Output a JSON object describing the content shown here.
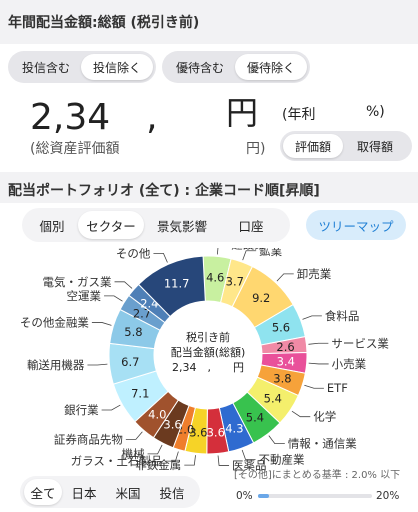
{
  "header": {
    "title": "年間配当金額:総額 (税引き前)",
    "segment1": [
      {
        "label": "投信含む",
        "selected": false
      },
      {
        "label": "投信除く",
        "selected": true
      }
    ],
    "segment2": [
      {
        "label": "優待含む",
        "selected": false
      },
      {
        "label": "優待除く",
        "selected": true
      }
    ]
  },
  "summary": {
    "amount": "2,34　,",
    "yen": "円",
    "annual_rate_open": "(年利",
    "percent_close": "%)",
    "asset_label": "(総資産評価額",
    "asset_yen": "円)",
    "basis_tabs": [
      {
        "label": "評価額",
        "selected": true
      },
      {
        "label": "取得額",
        "selected": false
      }
    ]
  },
  "portfolio": {
    "title": "配当ポートフォリオ (全て) : 企業コード順[昇順]",
    "tabs": [
      {
        "label": "個別",
        "selected": false
      },
      {
        "label": "セクター",
        "selected": true
      },
      {
        "label": "景気影響",
        "selected": false
      },
      {
        "label": "口座",
        "selected": false
      }
    ],
    "treemap_label": "ツリーマップ"
  },
  "donut_center": {
    "line1": "税引き前",
    "line2": "配当金額(総額)",
    "line3": "2,34　,　　円"
  },
  "chart_data": {
    "type": "pie",
    "donut": true,
    "unit": "%",
    "slices": [
      {
        "label": "建設業",
        "value": 4.6,
        "color": "#c8f0a0"
      },
      {
        "label": "鉱業",
        "value": 3.7,
        "color": "#ffe78a"
      },
      {
        "label": "卸売業",
        "value": 9.2,
        "color": "#ffd770"
      },
      {
        "label": "食料品",
        "value": 5.6,
        "color": "#8fe3ef"
      },
      {
        "label": "サービス業",
        "value": 2.6,
        "color": "#f08aa6"
      },
      {
        "label": "小売業",
        "value": 3.4,
        "color": "#e9509a"
      },
      {
        "label": "ETF",
        "value": 3.8,
        "color": "#f6a23a"
      },
      {
        "label": "化学",
        "value": 5.4,
        "color": "#f4ef6c"
      },
      {
        "label": "情報・通信業",
        "value": 5.4,
        "color": "#38c24e"
      },
      {
        "label": "不動産業",
        "value": 4.3,
        "color": "#2f6bd0"
      },
      {
        "label": "医薬品",
        "value": 3.6,
        "color": "#d42f3b"
      },
      {
        "label": "非鉄金属",
        "value": 3.6,
        "color": "#f6d327"
      },
      {
        "label": "ガラス・土石製品",
        "value": 2.0,
        "color": "#ef7e2c"
      },
      {
        "label": "機械",
        "value": 3.6,
        "color": "#6b3a1f"
      },
      {
        "label": "証券商品先物",
        "value": 4.0,
        "color": "#a0522d"
      },
      {
        "label": "銀行業",
        "value": 7.1,
        "color": "#bff0ff"
      },
      {
        "label": "輸送用機器",
        "value": 6.7,
        "color": "#a7e0f4"
      },
      {
        "label": "その他金融業",
        "value": 5.8,
        "color": "#8cc9e8"
      },
      {
        "label": "空運業",
        "value": 2.7,
        "color": "#6a9fcd"
      },
      {
        "label": "電気・ガス業",
        "value": 2.4,
        "color": "#4e7fb7"
      },
      {
        "label": "その他",
        "value": 11.7,
        "color": "#27477a"
      }
    ]
  },
  "region_tabs": [
    {
      "label": "全て",
      "selected": true
    },
    {
      "label": "日本",
      "selected": false
    },
    {
      "label": "米国",
      "selected": false
    },
    {
      "label": "投信",
      "selected": false
    }
  ],
  "threshold": {
    "label": "[その他]にまとめる基準 : 2.0% 以下",
    "min": "0%",
    "max": "20%",
    "value_percent": 2.0
  }
}
